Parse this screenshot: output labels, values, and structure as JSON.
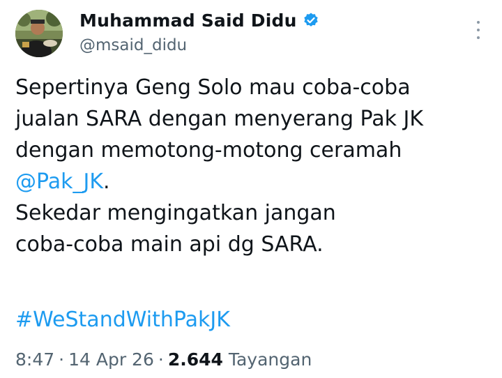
{
  "author": {
    "display_name": "Muhammad Said Didu",
    "handle": "@msaid_didu",
    "verified": true,
    "verified_color": "#1d9bf0"
  },
  "tweet": {
    "line1": "Sepertinya Geng Solo mau coba-coba",
    "line2": "jualan SARA dengan menyerang Pak JK",
    "line3": "dengan memotong-motong ceramah",
    "mention": "@Pak_JK",
    "mention_suffix": ".",
    "line5": "Sekedar mengingatkan jangan",
    "line6": "coba-coba main api dg SARA.",
    "hashtag": "#WeStandWithPakJK"
  },
  "meta": {
    "time": "8:47",
    "separator": "·",
    "date": "14 Apr 26",
    "views_count": "2.644",
    "views_label": "Tayangan"
  },
  "icons": {
    "avatar": "profile-photo",
    "verified": "verified-badge-icon",
    "more": "more-options-icon"
  },
  "colors": {
    "link": "#1d9bf0",
    "text": "#0f1419",
    "secondary": "#536471"
  }
}
